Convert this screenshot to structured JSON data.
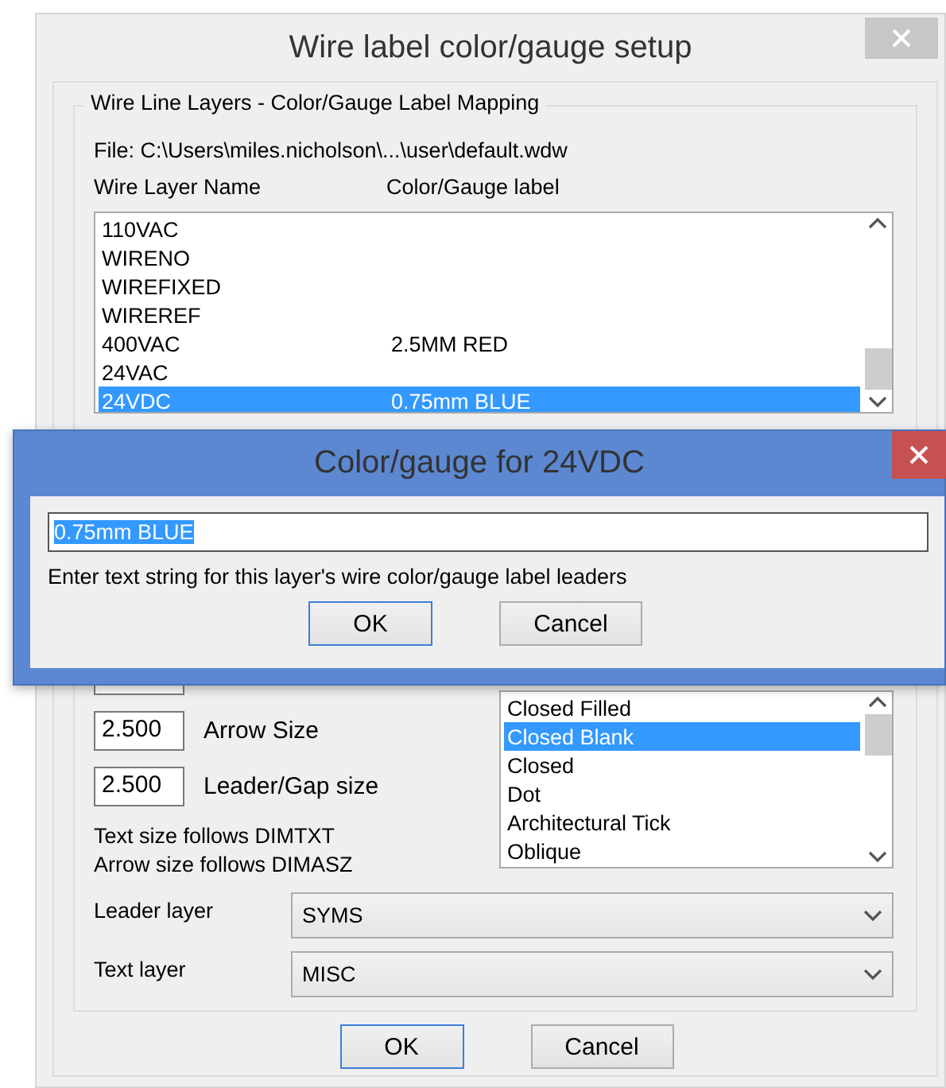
{
  "setup_dialog": {
    "title": "Wire label color/gauge setup",
    "group_title": "Wire Line Layers - Color/Gauge Label Mapping",
    "file": "File: C:\\Users\\miles.nicholson\\...\\user\\default.wdw",
    "columns": [
      "Wire Layer Name",
      "Color/Gauge label"
    ],
    "layers": [
      {
        "name": "110VAC",
        "selected": false
      },
      {
        "name": "WIRENO",
        "selected": false
      },
      {
        "name": "WIREFIXED",
        "selected": false
      },
      {
        "name": "WIREREF",
        "selected": false
      },
      {
        "name": "400VAC",
        "label": "2.5MM RED",
        "selected": false
      },
      {
        "name": "24VAC",
        "selected": false
      },
      {
        "name": "24VDC",
        "label": "0.75mm BLUE",
        "selected": true
      }
    ],
    "sizes": [
      {
        "value": "2.500",
        "label": "Arrow Size"
      },
      {
        "value": "2.500",
        "label": "Leader/Gap size"
      }
    ],
    "notes": [
      "Text size follows DIMTXT",
      "Arrow size follows DIMASZ"
    ],
    "arrow_styles": [
      {
        "name": "Closed Filled",
        "selected": false
      },
      {
        "name": "Closed Blank",
        "selected": true
      },
      {
        "name": "Closed",
        "selected": false
      },
      {
        "name": "Dot",
        "selected": false
      },
      {
        "name": "Architectural Tick",
        "selected": false
      },
      {
        "name": "Oblique",
        "selected": false
      }
    ],
    "leader_layer": {
      "label": "Leader layer",
      "value": "SYMS"
    },
    "text_layer": {
      "label": "Text layer",
      "value": "MISC"
    },
    "buttons": [
      {
        "label": "OK",
        "default": true
      },
      {
        "label": "Cancel",
        "default": false
      }
    ]
  },
  "input_dialog": {
    "title": "Color/gauge for 24VDC",
    "value": "0.75mm BLUE",
    "value_selected": true,
    "hint": "Enter text string for this layer's wire color/gauge label leaders",
    "buttons": [
      {
        "label": "OK",
        "default": true
      },
      {
        "label": "Cancel",
        "default": false
      }
    ]
  }
}
